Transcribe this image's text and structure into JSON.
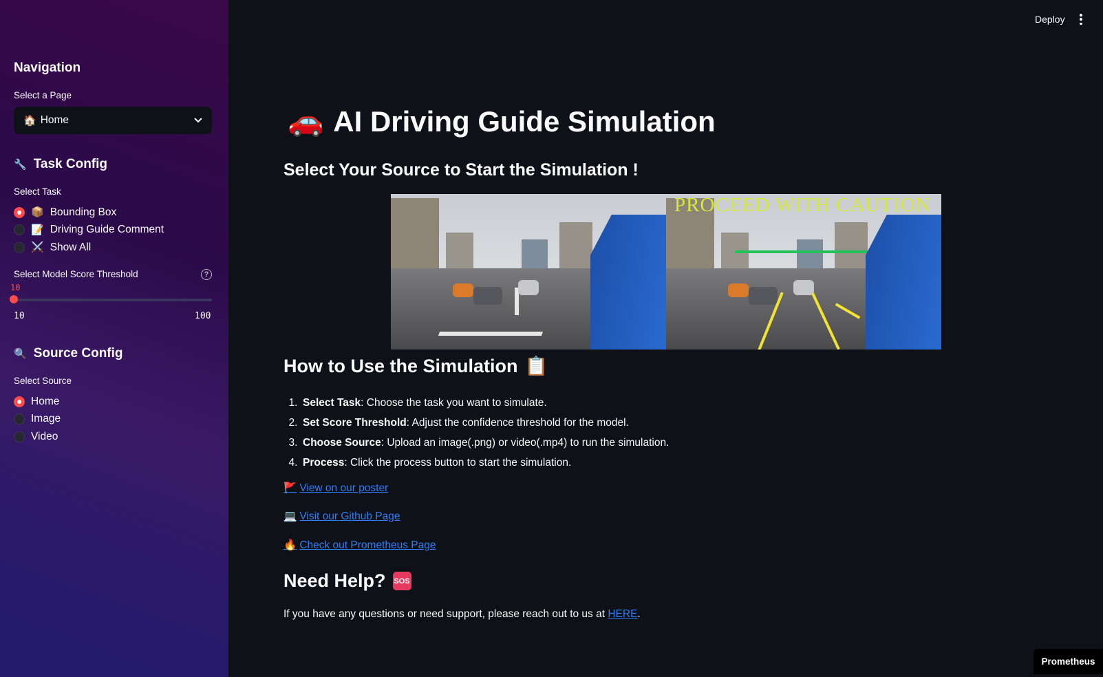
{
  "header": {
    "deploy_label": "Deploy",
    "menu_icon": "vertical-dots-icon"
  },
  "sidebar": {
    "navigation_heading": "Navigation",
    "select_page_label": "Select a Page",
    "select_page_value": "Home",
    "select_page_icon": "🏠",
    "task_config_heading": "Task Config",
    "task_config_icon": "🔧",
    "select_task_label": "Select Task",
    "tasks": [
      {
        "label": "Bounding Box",
        "icon": "📦",
        "selected": true
      },
      {
        "label": "Driving Guide Comment",
        "icon": "📝",
        "selected": false
      },
      {
        "label": "Show All",
        "icon": "⚔️",
        "selected": false
      }
    ],
    "threshold_label": "Select Model Score Threshold",
    "threshold_value": "10",
    "threshold_min": "10",
    "threshold_max": "100",
    "source_config_heading": "Source Config",
    "source_config_icon": "🔍",
    "select_source_label": "Select Source",
    "sources": [
      {
        "label": "Home",
        "selected": true
      },
      {
        "label": "Image",
        "selected": false
      },
      {
        "label": "Video",
        "selected": false
      }
    ]
  },
  "main": {
    "title": "AI Driving Guide Simulation",
    "title_icon": "🚗",
    "subtitle": "Select Your Source to Start the Simulation !",
    "hero_caption": "PROCEED WITH CAUTION",
    "how_to_heading": "How to Use the Simulation",
    "how_to_icon": "📋",
    "steps": [
      {
        "num": "1.",
        "bold": "Select Task",
        "text": ": Choose the task you want to simulate."
      },
      {
        "num": "2.",
        "bold": "Set Score Threshold",
        "text": ": Adjust the confidence threshold for the model."
      },
      {
        "num": "3.",
        "bold": "Choose Source",
        "text": ": Upload an image(.png) or video(.mp4) to run the simulation."
      },
      {
        "num": "4.",
        "bold": "Process",
        "text": ": Click the process button to start the simulation."
      }
    ],
    "links": {
      "poster": {
        "icon": "🚩",
        "label": "View on our poster"
      },
      "github": {
        "icon": "💻",
        "label": "Visit our Github Page"
      },
      "prometheus": {
        "icon": "🔥",
        "label": "Check out Prometheus Page"
      }
    },
    "need_help_heading": "Need Help?",
    "sos_label": "SOS",
    "help_text": "If you have any questions or need support, please reach out to us at ",
    "help_link": "HERE",
    "help_end": "."
  },
  "badge": {
    "label": "Prometheus"
  },
  "colors": {
    "accent": "#ff4b4b",
    "link": "#2e7cf6",
    "background": "#0e1117"
  }
}
